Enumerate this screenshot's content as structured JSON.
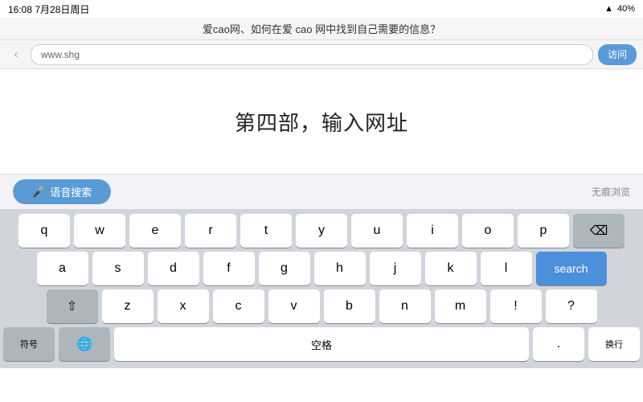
{
  "statusBar": {
    "time": "16:08",
    "date": "7月28日周日",
    "battery": "40%",
    "batteryIcon": "🔋"
  },
  "titleBar": {
    "text": "爱cao网、如何在爱 cao 网中找到自己需要的信息？"
  },
  "browserBar": {
    "backIcon": "‹",
    "urlPlaceholder": "www.shg",
    "visitLabel": "访问"
  },
  "mainContent": {
    "title": "第四部，输入网址"
  },
  "suggestionBar": {
    "voiceSearchLabel": "语音搜索",
    "incognitoLabel": "无痕浏览"
  },
  "keyboard": {
    "rows": [
      [
        "q",
        "w",
        "e",
        "r",
        "t",
        "y",
        "u",
        "i",
        "o",
        "p"
      ],
      [
        "a",
        "s",
        "d",
        "f",
        "g",
        "h",
        "j",
        "k",
        "l"
      ],
      [
        "z",
        "x",
        "c",
        "v",
        "b",
        "n",
        "m"
      ]
    ],
    "searchLabel": "search",
    "backspaceSymbol": "⌫",
    "shiftSymbol": "⇧",
    "symLabel": "符号",
    "micSymbol": "🌐",
    "spaceLabel": "空格",
    "dotLabel": ".",
    "questionLabel": "?"
  }
}
